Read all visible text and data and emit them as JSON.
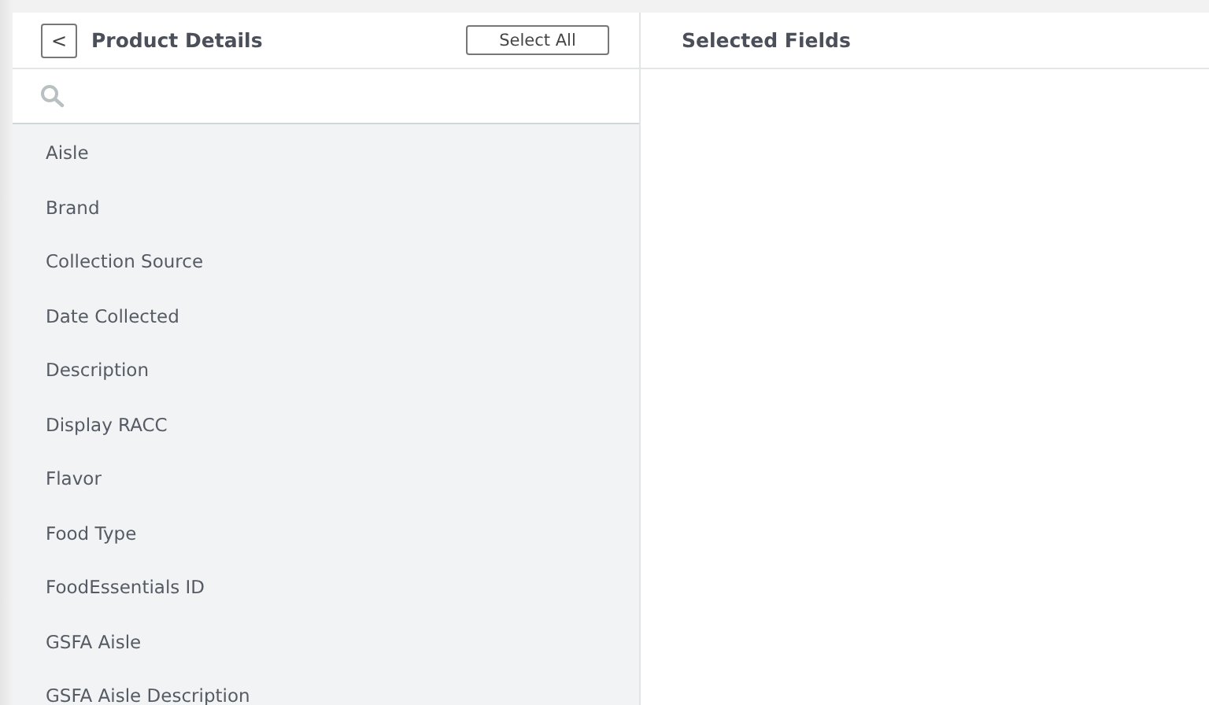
{
  "left_panel": {
    "back_button": "<",
    "title": "Product Details",
    "select_all_button": "Select All",
    "fields": [
      {
        "label": "Aisle"
      },
      {
        "label": "Brand"
      },
      {
        "label": "Collection Source"
      },
      {
        "label": "Date Collected"
      },
      {
        "label": "Description"
      },
      {
        "label": "Display RACC"
      },
      {
        "label": "Flavor"
      },
      {
        "label": "Food Type"
      },
      {
        "label": "FoodEssentials ID"
      },
      {
        "label": "GSFA Aisle"
      },
      {
        "label": "GSFA Aisle Description"
      }
    ]
  },
  "right_panel": {
    "title": "Selected Fields"
  }
}
